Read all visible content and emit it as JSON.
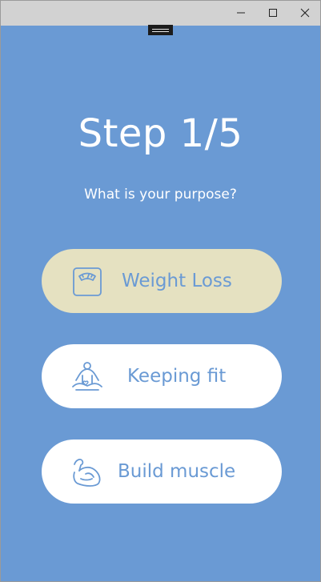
{
  "window": {
    "minimize_icon": "minimize-icon",
    "maximize_icon": "maximize-icon",
    "close_icon": "close-icon"
  },
  "header": {
    "step": "Step 1/5",
    "question": "What is your purpose?"
  },
  "options": [
    {
      "label": "Weight Loss",
      "icon": "scale-icon",
      "selected": true
    },
    {
      "label": "Keeping fit",
      "icon": "yoga-icon",
      "selected": false
    },
    {
      "label": "Build muscle",
      "icon": "muscle-icon",
      "selected": false
    }
  ],
  "colors": {
    "background": "#6a9ad4",
    "option_bg": "#ffffff",
    "option_selected_bg": "#e5e1c1",
    "accent": "#6a9ad4"
  }
}
